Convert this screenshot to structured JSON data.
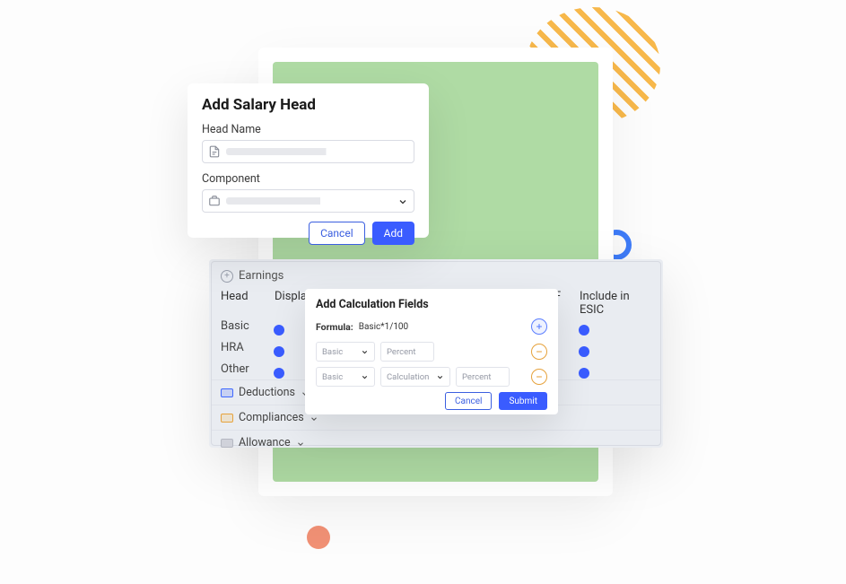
{
  "salaryHead": {
    "title": "Add Salary Head",
    "headNameLabel": "Head Name",
    "componentLabel": "Component",
    "cancel": "Cancel",
    "add": "Add"
  },
  "panel": {
    "section": "Earnings",
    "headers": {
      "head": "Head",
      "display": "Display",
      "pfSuffix": "F",
      "esic": "Include in ESIC"
    },
    "rows": [
      {
        "head": "Basic"
      },
      {
        "head": "HRA"
      },
      {
        "head": "Other"
      }
    ],
    "accordions": {
      "deductions": "Deductions",
      "compliances": "Compliances",
      "allowance": "Allowance"
    }
  },
  "calc": {
    "title": "Add Calculation Fields",
    "formulaLabel": "Formula:",
    "formulaValue": "Basic*1/100",
    "options": {
      "basic": "Basic",
      "percent": "Percent",
      "calculation": "Calculation"
    },
    "cancel": "Cancel",
    "submit": "Submit"
  }
}
